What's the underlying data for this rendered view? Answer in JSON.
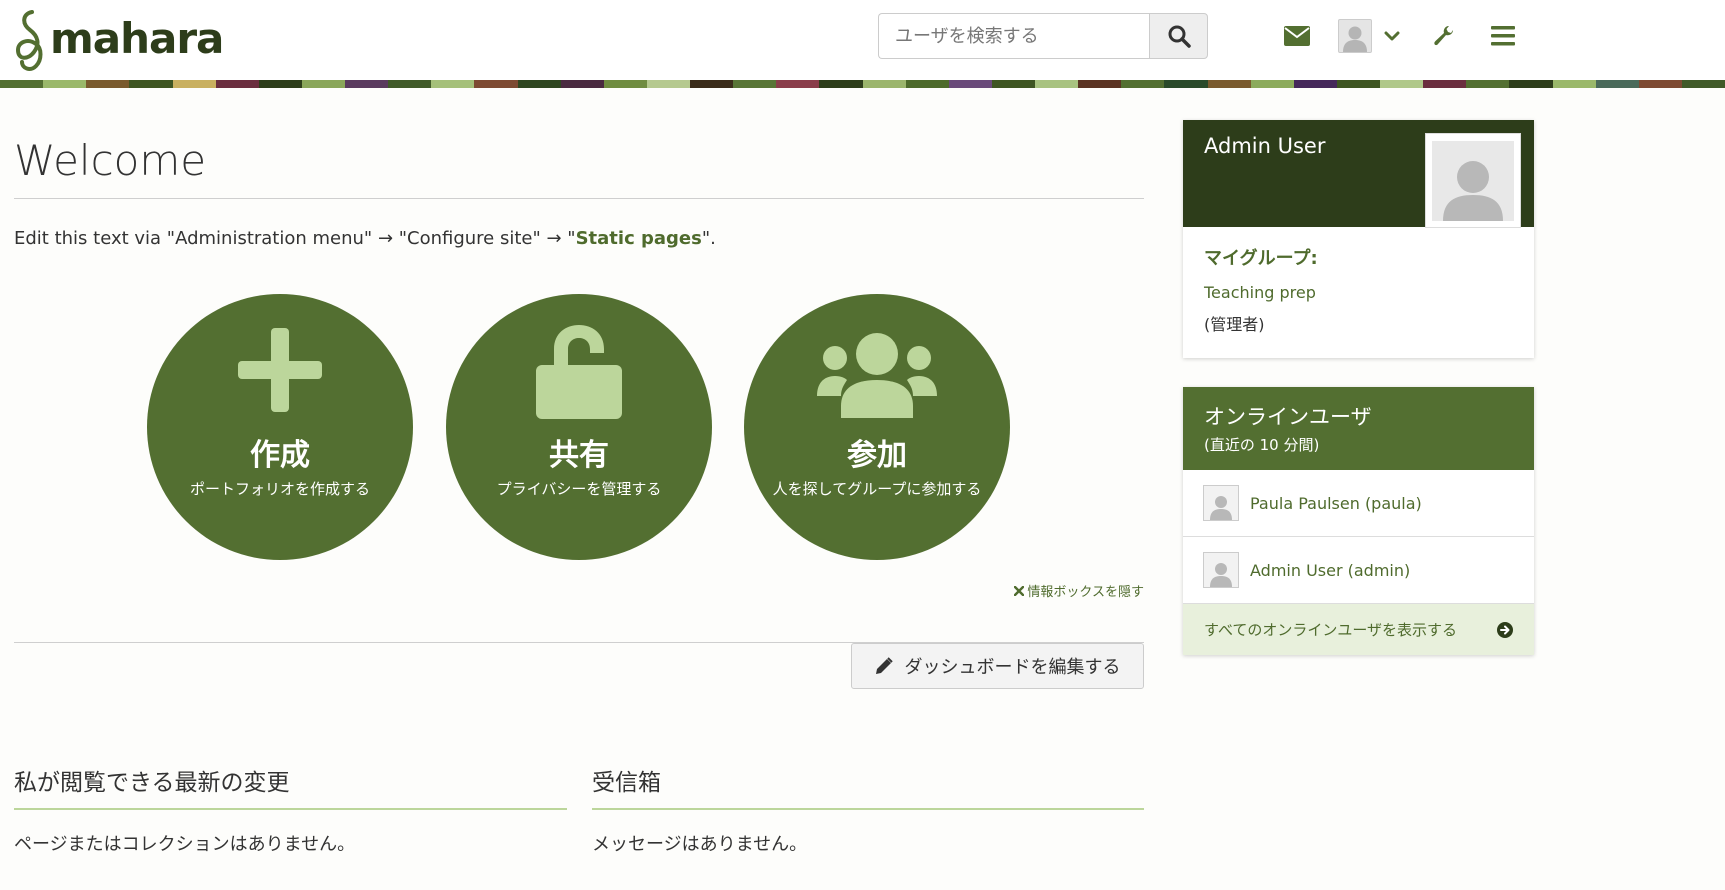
{
  "header": {
    "logo_text": "mahara",
    "search": {
      "placeholder": "ユーザを検索する",
      "value": ""
    },
    "icons": [
      "envelope-icon",
      "user-avatar",
      "chevron-down-icon",
      "wrench-icon",
      "menu-icon"
    ]
  },
  "colors": {
    "brand_dark": "#2d3d1a",
    "brand": "#536f31",
    "brand_light": "#bcd69b",
    "link": "#4f6b2d"
  },
  "main": {
    "title": "Welcome",
    "intro_before": "Edit this text via \"Administration menu\" → \"Configure site\" → \"",
    "intro_link": "Static pages",
    "intro_after": "\".",
    "actions": [
      {
        "title": "作成",
        "subtitle": "ポートフォリオを作成する",
        "icon": "plus-icon"
      },
      {
        "title": "共有",
        "subtitle": "プライバシーを管理する",
        "icon": "unlock-icon"
      },
      {
        "title": "参加",
        "subtitle": "人を探してグループに参加する",
        "icon": "group-icon"
      }
    ],
    "hide_info_label": "情報ボックスを隠す",
    "edit_dashboard_label": "ダッシュボードを編集する",
    "sections": [
      {
        "title": "私が閲覧できる最新の変更",
        "empty": "ページまたはコレクションはありません。"
      },
      {
        "title": "受信箱",
        "empty": "メッセージはありません。"
      }
    ]
  },
  "sidebar": {
    "profile": {
      "name": "Admin User",
      "groups_label": "マイグループ:",
      "group_name": "Teaching prep",
      "group_role": "(管理者)"
    },
    "online": {
      "title": "オンラインユーザ",
      "subtitle_prefix": "(直近の ",
      "subtitle_minutes": "10",
      "subtitle_suffix": " 分間)",
      "users": [
        "Paula Paulsen (paula)",
        "Admin User (admin)"
      ],
      "show_all_label": "すべてのオンラインユーザを表示する"
    }
  }
}
